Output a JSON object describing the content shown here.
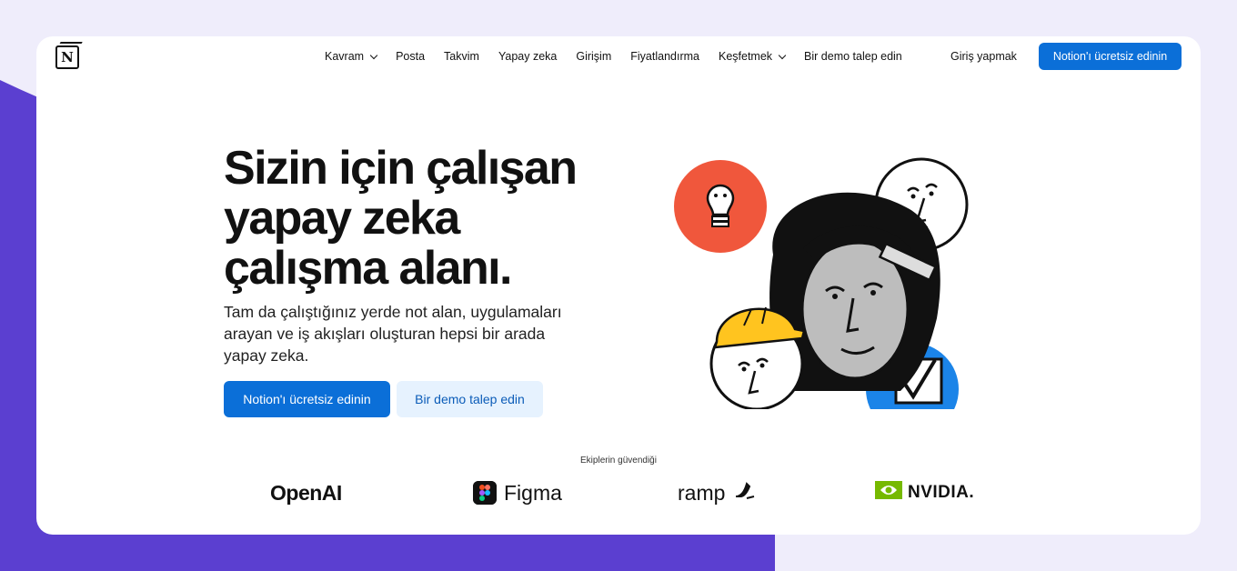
{
  "brand": {
    "logo_letter": "N"
  },
  "nav": {
    "items": [
      {
        "label": "Kavram",
        "dropdown": true
      },
      {
        "label": "Posta",
        "dropdown": false
      },
      {
        "label": "Takvim",
        "dropdown": false
      },
      {
        "label": "Yapay zeka",
        "dropdown": false
      },
      {
        "label": "Girişim",
        "dropdown": false
      },
      {
        "label": "Fiyatlandırma",
        "dropdown": false
      },
      {
        "label": "Keşfetmek",
        "dropdown": true
      },
      {
        "label": "Bir demo talep edin",
        "dropdown": false
      }
    ],
    "login_label": "Giriş yapmak",
    "cta_label": "Notion'ı ücretsiz edinin"
  },
  "hero": {
    "title": "Sizin için çalışan yapay zeka çalışma alanı.",
    "subtitle": "Tam da çalıştığınız yerde not alan, uygulamaları arayan ve iş akışları oluşturan hepsi bir arada yapay zeka.",
    "primary_button": "Notion'ı ücretsiz edinin",
    "secondary_button": "Bir demo talep edin"
  },
  "trusted": {
    "label": "Ekiplerin güvendiği",
    "logos": [
      "OpenAI",
      "Figma",
      "ramp",
      "NVIDIA."
    ]
  },
  "colors": {
    "accent": "#0b6fd8",
    "secondary_bg": "#e6f2fe",
    "page_bg": "#efedfb",
    "blob": "#5b3fd0",
    "illustration_red": "#f0573c",
    "illustration_blue": "#1b84e8",
    "illustration_yellow": "#ffc41f"
  },
  "icons": [
    "notion-logo-icon",
    "chevron-down-icon",
    "figma-logo-icon",
    "ramp-logo-icon",
    "nvidia-logo-icon"
  ]
}
